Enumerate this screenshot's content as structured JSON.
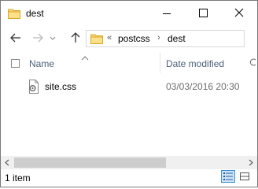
{
  "window": {
    "title": "dest"
  },
  "address": {
    "overflow": "«",
    "crumbs": [
      "postcss",
      "dest"
    ],
    "separator": "›"
  },
  "columns": {
    "name": "Name",
    "date_modified": "Date modified"
  },
  "files": [
    {
      "name": "site.css",
      "date_modified": "03/03/2016 20:30",
      "icon": "css-file-icon"
    }
  ],
  "status": {
    "item_count": "1 item"
  },
  "colors": {
    "header_text": "#4c607a",
    "accent": "#0078d7",
    "folder": "#f8d775"
  }
}
